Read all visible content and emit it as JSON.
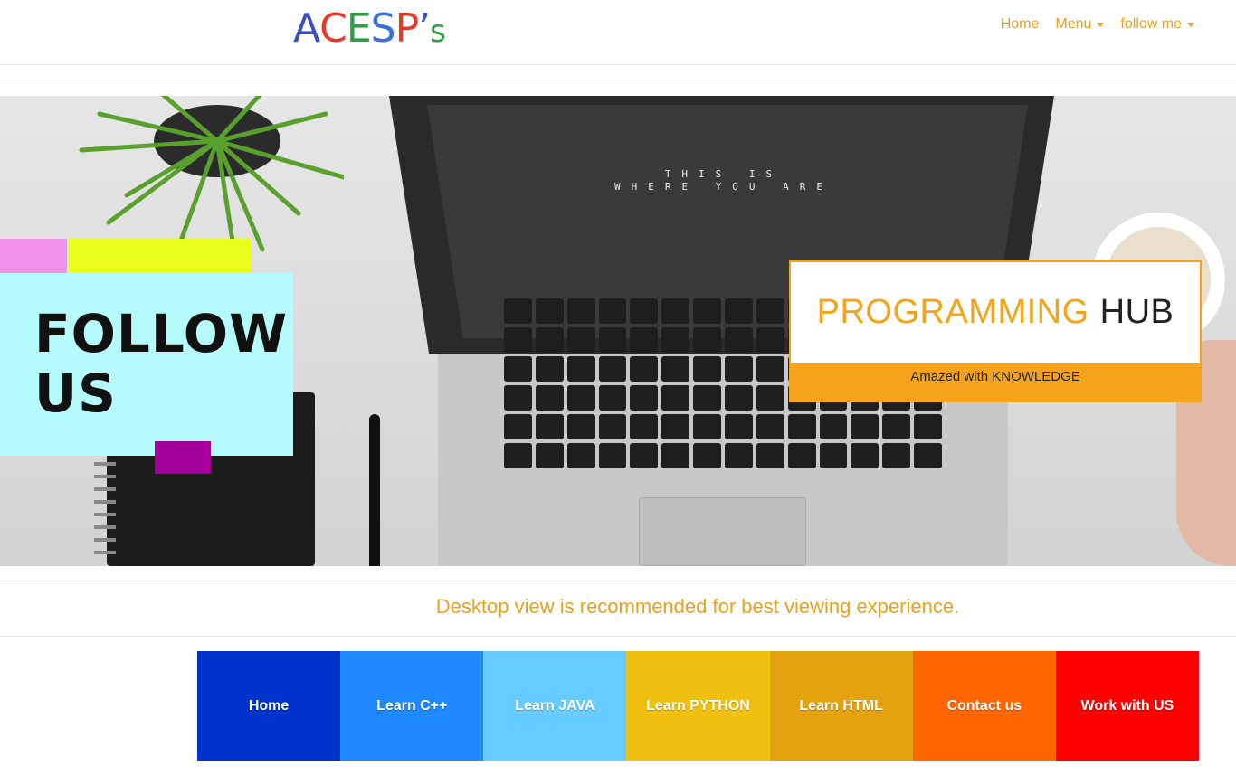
{
  "brand": {
    "letters": [
      {
        "ch": "A",
        "color": "#3a4fc0"
      },
      {
        "ch": "C",
        "color": "#e33a2c"
      },
      {
        "ch": "E",
        "color": "#2f9e44"
      },
      {
        "ch": "S",
        "color": "#3a6fd8"
      },
      {
        "ch": "P",
        "color": "#e33a2c"
      },
      {
        "ch": "’",
        "color": "#3a4fc0"
      },
      {
        "ch": "s",
        "color": "#2f9e44"
      }
    ]
  },
  "nav": {
    "home": "Home",
    "menu": "Menu",
    "follow": "follow me"
  },
  "hero": {
    "screen_line1": "THIS IS",
    "screen_line2": "WHERE YOU ARE",
    "follow_line1": "FOLLOW",
    "follow_line2": "US",
    "hub_word1": "PROGRAMMING",
    "hub_word2": "HUB",
    "hub_tagline": "Amazed with KNOWLEDGE"
  },
  "notice": "Desktop view is recommended for best viewing experience.",
  "tiles": [
    {
      "label": "Home",
      "color": "#0033cc"
    },
    {
      "label": "Learn C++",
      "color": "#1e88ff"
    },
    {
      "label": "Learn JAVA",
      "color": "#66ccff"
    },
    {
      "label": "Learn PYTHON",
      "color": "#f0c010"
    },
    {
      "label": "Learn HTML",
      "color": "#e5a20f"
    },
    {
      "label": "Contact us",
      "color": "#ff6600"
    },
    {
      "label": "Work with US",
      "color": "#ff0000"
    }
  ],
  "colors": {
    "accent": "#e8a21d",
    "hub_orange": "#f4a31a"
  }
}
